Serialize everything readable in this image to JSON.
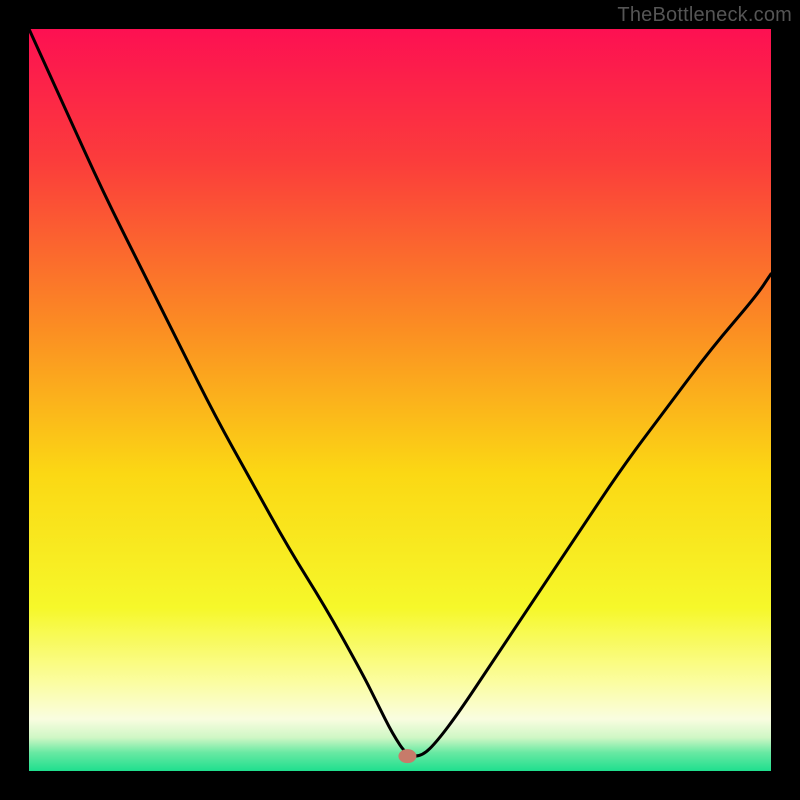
{
  "watermark": "TheBottleneck.com",
  "chart_data": {
    "type": "line",
    "title": "",
    "xlabel": "",
    "ylabel": "",
    "xlim": [
      0,
      100
    ],
    "ylim": [
      0,
      100
    ],
    "grid": false,
    "legend": false,
    "marker": {
      "x": 51,
      "y": 2,
      "color": "#c77b6a"
    },
    "series": [
      {
        "name": "curve",
        "x": [
          0,
          5,
          10,
          15,
          20,
          25,
          30,
          35,
          40,
          45,
          47,
          49,
          51,
          53,
          55,
          58,
          62,
          68,
          74,
          80,
          86,
          92,
          98,
          100
        ],
        "values": [
          100,
          89,
          78,
          68,
          58,
          48,
          39,
          30,
          22,
          13,
          9,
          5,
          2,
          2,
          4,
          8,
          14,
          23,
          32,
          41,
          49,
          57,
          64,
          67
        ]
      }
    ],
    "background_gradient": {
      "stops": [
        {
          "offset": 0.0,
          "color": "#fd1052"
        },
        {
          "offset": 0.18,
          "color": "#fb3d3b"
        },
        {
          "offset": 0.4,
          "color": "#fb8c23"
        },
        {
          "offset": 0.6,
          "color": "#fbd814"
        },
        {
          "offset": 0.78,
          "color": "#f6f82a"
        },
        {
          "offset": 0.88,
          "color": "#fbfda0"
        },
        {
          "offset": 0.93,
          "color": "#f9fde0"
        },
        {
          "offset": 0.955,
          "color": "#cff7c5"
        },
        {
          "offset": 0.975,
          "color": "#69e9a3"
        },
        {
          "offset": 1.0,
          "color": "#1fdf8e"
        }
      ]
    }
  }
}
